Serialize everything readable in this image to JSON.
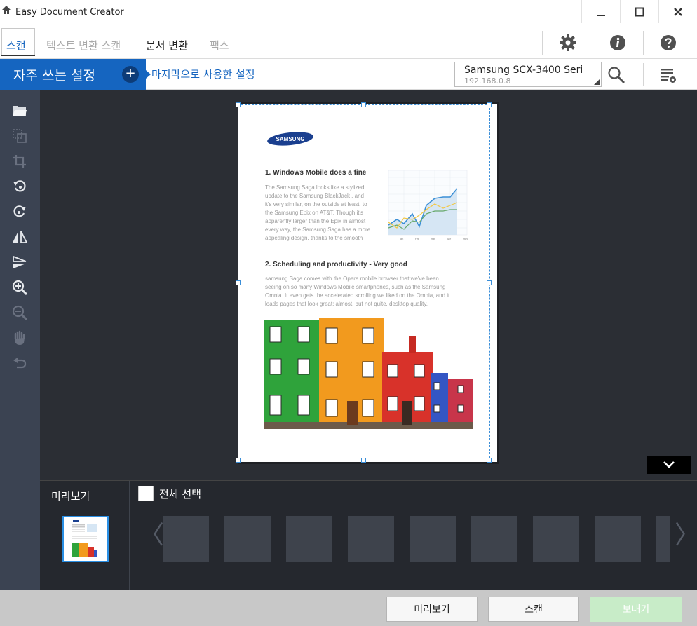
{
  "window": {
    "title": "Easy Document Creator",
    "minimize_icon": "minimize-icon",
    "maximize_icon": "maximize-icon",
    "close_icon": "close-icon"
  },
  "tabs": [
    {
      "label": "스캔",
      "state": "active"
    },
    {
      "label": "텍스트 변환 스캔",
      "state": "disabled"
    },
    {
      "label": "문서 변환",
      "state": "normal"
    },
    {
      "label": "팩스",
      "state": "disabled"
    }
  ],
  "toolbar_icons": [
    "gear-icon",
    "info-icon",
    "help-icon"
  ],
  "favorites": {
    "label": "자주 쓰는 설정",
    "add_symbol": "+",
    "last_used_label": "마지막으로 사용한 설정"
  },
  "device": {
    "name": "Samsung SCX-3400 Seri",
    "ip": "192.168.0.8"
  },
  "sidebar_tools": [
    "open-folder-icon",
    "auto-select-icon",
    "crop-icon",
    "rotate-left-icon",
    "rotate-right-icon",
    "flip-horizontal-icon",
    "flip-vertical-icon",
    "zoom-in-icon",
    "zoom-out-icon",
    "hand-pan-icon",
    "undo-icon"
  ],
  "document": {
    "logo_text": "SAMSUNG",
    "heading1": "1. Windows Mobile does a fine",
    "para1": [
      "The Samsung Saga looks like a stylized",
      "update to the Samsung BlackJack , and",
      "it's very similar, on the outside at least, to",
      "the Samsung Epix on AT&T. Though it's",
      "apparently larger than the Epix in almost",
      "every way, the Samsung Saga has a more",
      "appealing design, thanks to the smooth"
    ],
    "heading2": "2. Scheduling and productivity - Very good",
    "para2": [
      " samsung Saga comes with the Opera mobile browser that we've been",
      "seeing on so many Windows Mobile smartphones, such as the Samsung",
      "Omnia. It even gets the accelerated scrolling we liked on the Omnia, and it",
      "loads pages that look great; almost, but not quite, desktop quality."
    ],
    "chart_x_labels": [
      "Jan",
      "Feb",
      "Mar",
      "Apr",
      "May"
    ]
  },
  "preview": {
    "label": "미리보기",
    "select_all_label": "전체 선택",
    "slot_count": 9
  },
  "footer": {
    "preview_button": "미리보기",
    "scan_button": "스캔",
    "send_button": "보내기"
  },
  "colors": {
    "accent": "#1565c0",
    "sidebar": "#3b4352",
    "canvas": "#2b2e34",
    "selection": "#3a8ed8",
    "send_disabled": "#c8ecc8"
  }
}
